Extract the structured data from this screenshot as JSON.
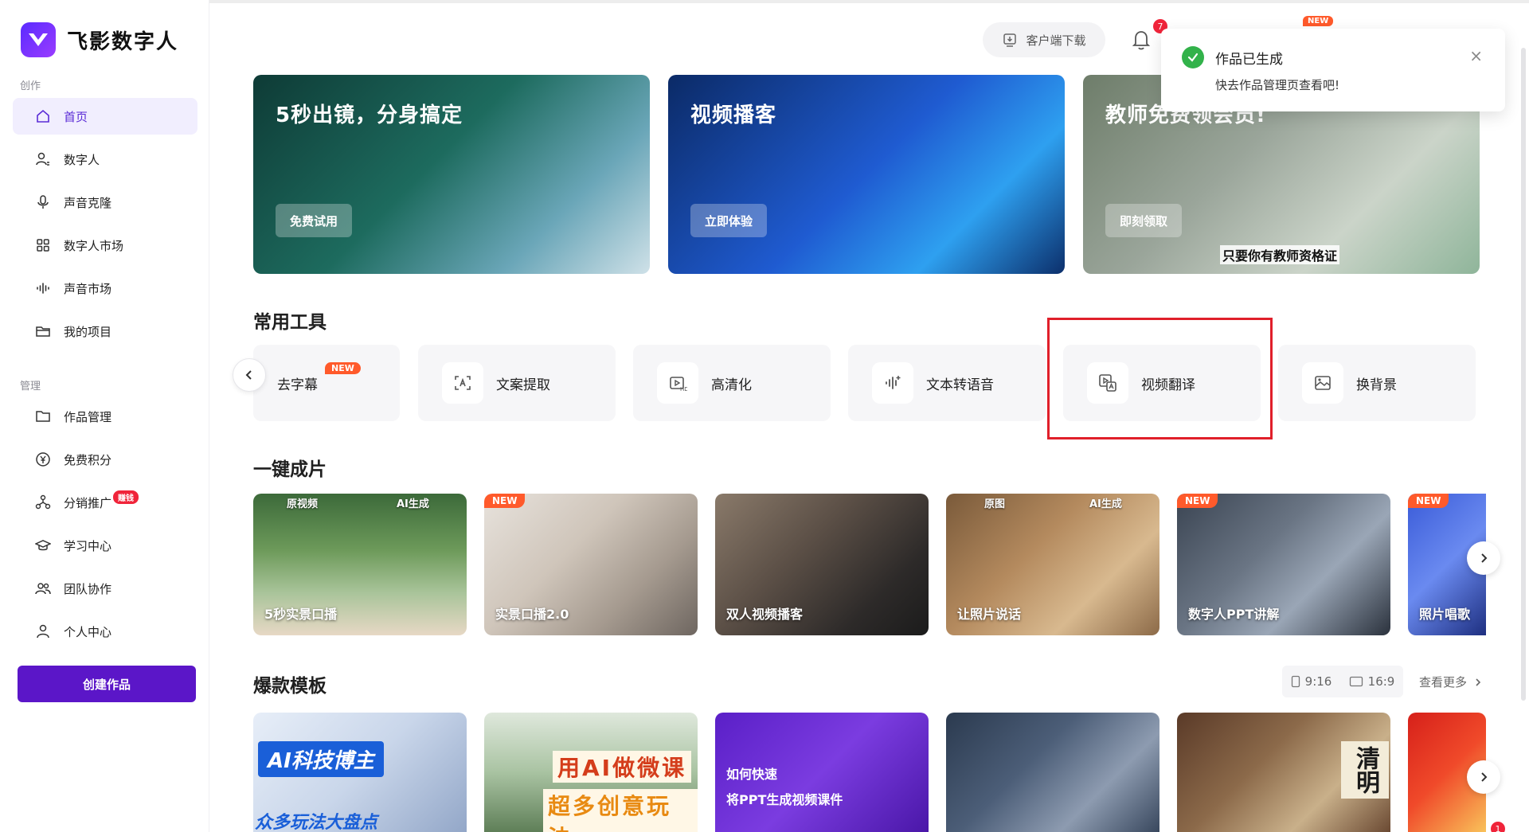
{
  "app": {
    "name": "飞影数字人"
  },
  "sidebar": {
    "section_create": "创作",
    "section_manage": "管理",
    "items": [
      {
        "label": "首页",
        "icon": "home-icon",
        "active": true
      },
      {
        "label": "数字人",
        "icon": "avatar-icon"
      },
      {
        "label": "声音克隆",
        "icon": "microphone-icon"
      },
      {
        "label": "数字人市场",
        "icon": "grid-icon"
      },
      {
        "label": "声音市场",
        "icon": "waveform-icon"
      },
      {
        "label": "我的项目",
        "icon": "folder-open-icon"
      },
      {
        "label": "作品管理",
        "icon": "folder-icon"
      },
      {
        "label": "免费积分",
        "icon": "yen-coin-icon"
      },
      {
        "label": "分销推广",
        "icon": "share-network-icon",
        "badge": "赚钱"
      },
      {
        "label": "学习中心",
        "icon": "graduation-cap-icon"
      },
      {
        "label": "团队协作",
        "icon": "team-icon"
      },
      {
        "label": "个人中心",
        "icon": "user-icon"
      }
    ],
    "create_button": "创建作品"
  },
  "header": {
    "download_label": "客户端下载",
    "notification_count": "7",
    "new_tag": "NEW"
  },
  "toast": {
    "title": "作品已生成",
    "body": "快去作品管理页查看吧!",
    "close": "×"
  },
  "banners": [
    {
      "title": "5秒出镜，分身搞定",
      "button": "免费试用"
    },
    {
      "title": "视频播客",
      "button": "立即体验"
    },
    {
      "title": "教师免费领会员!",
      "button": "即刻领取",
      "subtitle": "只要你有教师资格证"
    }
  ],
  "tools": {
    "title": "常用工具",
    "items": [
      {
        "label": "去字幕",
        "icon": "subtitle-remove-icon",
        "badge": "NEW"
      },
      {
        "label": "文案提取",
        "icon": "text-extract-icon"
      },
      {
        "label": "高清化",
        "icon": "hd-video-icon"
      },
      {
        "label": "文本转语音",
        "icon": "text-to-speech-icon"
      },
      {
        "label": "视频翻译",
        "icon": "video-translate-icon"
      },
      {
        "label": "换背景",
        "icon": "image-background-icon"
      }
    ]
  },
  "oneclick": {
    "title": "一键成片",
    "items": [
      {
        "label": "5秒实景口播",
        "tags": [
          "原视频",
          "AI生成"
        ]
      },
      {
        "label": "实景口播2.0",
        "badge": "NEW"
      },
      {
        "label": "双人视频播客"
      },
      {
        "label": "让照片说话",
        "tags": [
          "原图",
          "AI生成"
        ]
      },
      {
        "label": "数字人PPT讲解",
        "badge": "NEW"
      },
      {
        "label": "照片唱歌",
        "badge": "NEW"
      }
    ]
  },
  "templates": {
    "title": "爆款模板",
    "ratio_portrait": "9:16",
    "ratio_landscape": "16:9",
    "more": "查看更多",
    "items": [
      {
        "line1": "AI科技博主",
        "line2": "众多玩法大盘点"
      },
      {
        "line1": "用AI做微课",
        "line2": "超多创意玩法"
      },
      {
        "line1": "如何快速",
        "line2": "将PPT生成视频课件"
      },
      {
        "line1": ""
      },
      {
        "line1": "清明"
      },
      {
        "line1": ""
      }
    ]
  },
  "corner_badge": "1",
  "colors": {
    "brand": "#5b16c8",
    "active_nav_bg": "#f1eefe",
    "badge_red": "#f0243a",
    "new_orange": "#ff5a2b",
    "highlight_red": "#e01f2a"
  }
}
